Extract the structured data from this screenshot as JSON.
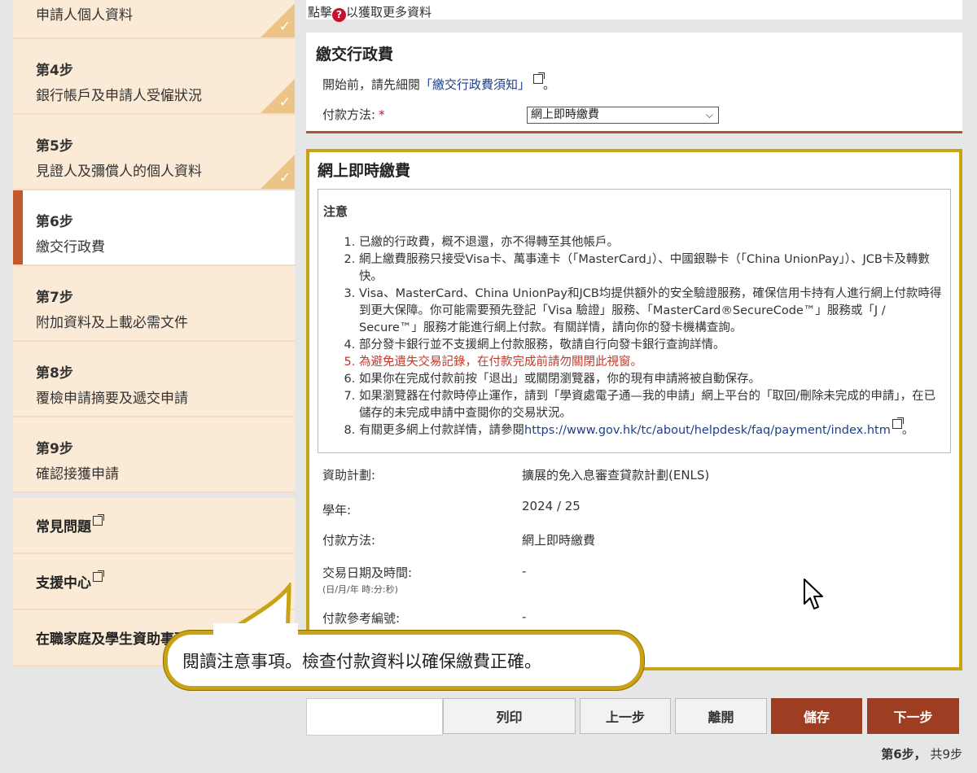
{
  "sidebar": {
    "steps": [
      {
        "num": "",
        "name": "申請人個人資料",
        "done": true
      },
      {
        "num": "第4步",
        "name": "銀行帳戶及申請人受僱狀況",
        "done": true
      },
      {
        "num": "第5步",
        "name": "見證人及彌償人的個人資料",
        "done": true
      },
      {
        "num": "第6步",
        "name": "繳交行政費",
        "active": true
      },
      {
        "num": "第7步",
        "name": "附加資料及上載必需文件"
      },
      {
        "num": "第8步",
        "name": "覆檢申請摘要及遞交申請"
      },
      {
        "num": "第9步",
        "name": "確認接獲申請"
      }
    ],
    "tick_char": "✓",
    "links": [
      {
        "label": "常見問題"
      },
      {
        "label": "支援中心"
      },
      {
        "label": "在職家庭及學生資助事務處"
      }
    ]
  },
  "topnote": {
    "prefix": "點擊",
    "icon": "?",
    "suffix": "以獲取更多資料"
  },
  "fee": {
    "title": "繳交行政費",
    "intro_prefix": "開始前，請先細閱",
    "intro_link": "「繳交行政費須知」",
    "intro_suffix": "。",
    "method_label": "付款方法:",
    "required": "*",
    "method_value": "網上即時繳費"
  },
  "detail": {
    "title": "網上即時繳費",
    "notice_title": "注意",
    "items": [
      "已繳的行政費，概不退還，亦不得轉至其他帳戶。",
      "網上繳費服務只接受Visa卡、萬事達卡（「MasterCard」）、中國銀聯卡（「China UnionPay」）、JCB卡及轉數快。",
      "Visa、MasterCard、China UnionPay和JCB均提供額外的安全驗證服務，確保信用卡持有人進行網上付款時得到更大保障。你可能需要預先登記「Visa 驗證」服務、「MasterCard®SecureCode™」服務或「J / Secure™」服務才能進行網上付款。有關詳情，請向你的發卡機構查詢。",
      "部分發卡銀行並不支援網上付款服務，敬請自行向發卡銀行查詢詳情。",
      "為避免遺失交易記錄，在付款完成前請勿關閉此視窗。",
      "如果你在完成付款前按「退出」或關閉瀏覽器，你的現有申請將被自動保存。",
      "如果瀏覽器在付款時停止運作，請到「學資處電子通—我的申請」網上平台的「取回/刪除未完成的申請」，在已儲存的未完成申請中查閱你的交易狀況。"
    ],
    "item8_prefix": "有關更多網上付款詳情，請參閱",
    "item8_link": "https://www.gov.hk/tc/about/helpdesk/faq/payment/index.htm",
    "item8_suffix": "。",
    "info": [
      {
        "label": "資助計劃:",
        "value": "擴展的免入息審查貸款計劃(ENLS)"
      },
      {
        "label": "學年:",
        "value": "2024 / 25"
      },
      {
        "label": "付款方法:",
        "value": "網上即時繳費"
      },
      {
        "label": "交易日期及時間:",
        "sub": "(日/月/年 時:分:秒)",
        "value": "-"
      },
      {
        "label": "付款參考編號:",
        "value": "-"
      }
    ]
  },
  "buttons": {
    "print": "列印",
    "prev": "上一步",
    "leave": "離開",
    "save": "儲存",
    "next": "下一步"
  },
  "step_count": {
    "current": "第6步，",
    "total": "共9步"
  },
  "callout": "閱讀注意事項。檢查付款資料以確保繳費正確。",
  "colors": {
    "accent": "#9d3e22",
    "highlight": "#c9a215",
    "sidebar_bg": "#fbead6"
  }
}
